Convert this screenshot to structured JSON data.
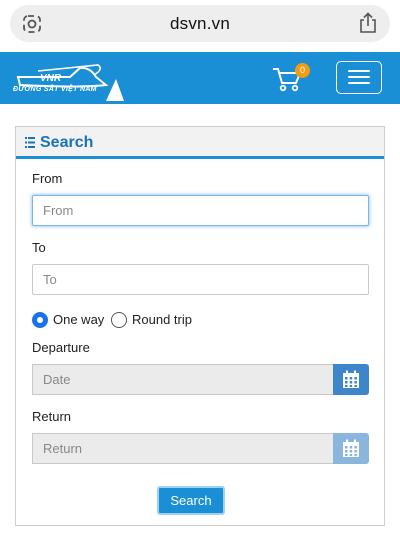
{
  "browser": {
    "url": "dsvn.vn",
    "left_icon": "site-settings-icon",
    "right_icon": "share-icon"
  },
  "header": {
    "logo_mark": "VNR",
    "logo_text": "ĐƯỜNG SẮT VIỆT NAM",
    "cart_count": "0",
    "brand_color": "#1a8fd6"
  },
  "search_panel": {
    "title": "Search",
    "from": {
      "label": "From",
      "placeholder": "From",
      "value": ""
    },
    "to": {
      "label": "To",
      "placeholder": "To",
      "value": ""
    },
    "trip_type": {
      "one_way": "One way",
      "round_trip": "Round trip",
      "selected": "One way"
    },
    "departure": {
      "label": "Departure",
      "placeholder": "Date"
    },
    "return": {
      "label": "Return",
      "placeholder": "Return"
    },
    "search_button": "Search"
  }
}
